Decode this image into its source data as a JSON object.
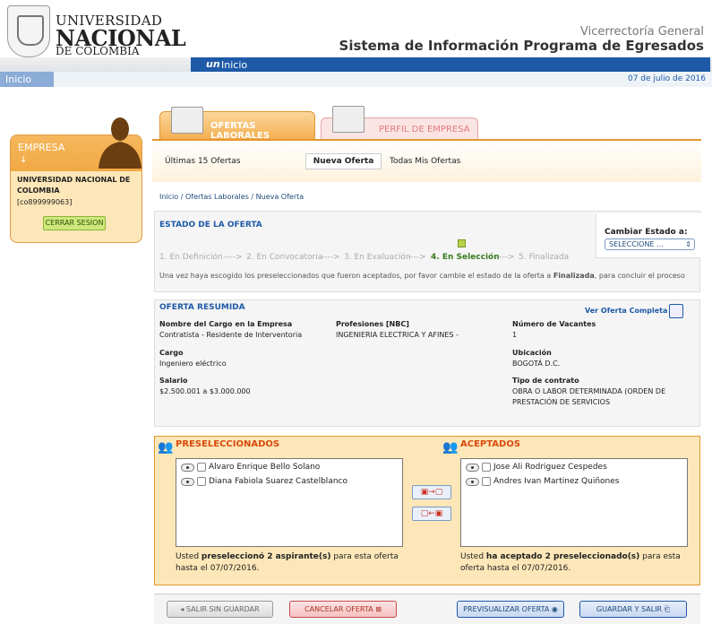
{
  "header": {
    "logo_line1": "UNIVERSIDAD",
    "logo_line2": "NACIONAL",
    "logo_line3": "DE COLOMBIA",
    "vicerrectoria": "Vicerrectoría General",
    "system_title": "Sistema de Información Programa de Egresados",
    "nav_tab": "Inicio",
    "nav_tab_logo": "un",
    "breadcrumb_top": "Inicio",
    "date": "07 de julio de 2016"
  },
  "sidebar": {
    "title": "EMPRESA",
    "arrow": "↓",
    "company_name": "UNIVERSIDAD NACIONAL DE COLOMBIA",
    "company_code": "[co899999063]",
    "logout_label": "CERRAR SESION"
  },
  "tabs": [
    {
      "label": "OFERTAS LABORALES"
    },
    {
      "label": "PERFIL DE EMPRESA"
    }
  ],
  "subnav": {
    "item1": "Últimas 15 Ofertas",
    "item2": "Nueva Oferta",
    "item3": "Todas Mis Ofertas"
  },
  "breadcrumb": "Inicio / Ofertas Laborales / Nueva Oferta",
  "estado": {
    "title": "ESTADO DE LA OFERTA",
    "steps": [
      "1. En Definición",
      "2. En Convocatoria",
      "3. En Evaluación",
      "4. En Selección",
      "5. Finalizada"
    ],
    "arrow": "---->",
    "cambiar_label": "Cambiar Estado a:",
    "select_value": "SELECCIONE ...",
    "message_pre": "Una vez haya escogido los preseleccionados que fueron aceptados, por favor cambie el estado de la oferta a ",
    "message_bold": "Finalizada",
    "message_post": ", para concluir el proceso"
  },
  "oferta": {
    "title": "OFERTA RESUMIDA",
    "ver_link": "Ver Oferta Completa",
    "cargo_empresa_label": "Nombre del Cargo en la Empresa",
    "cargo_empresa": "Contratista - Residente de Interventoria",
    "profesiones_label": "Profesiones [NBC]",
    "profesiones": "INGENIERIA ELECTRICA Y AFINES -",
    "vacantes_label": "Número de Vacantes",
    "vacantes": "1",
    "cargo_label": "Cargo",
    "cargo": "Ingeniero eléctrico",
    "ubicacion_label": "Ubicación",
    "ubicacion": "BOGOTÁ D.C.",
    "salario_label": "Salario",
    "salario": "$2.500.001 a $3.000.000",
    "contrato_label": "Tipo de contrato",
    "contrato_l1": "OBRA O LABOR DETERMINADA (ORDEN DE",
    "contrato_l2": "PRESTACIÓN DE SERVICIOS"
  },
  "seleccion": {
    "pre_title": "PRESELECCIONADOS",
    "acc_title": "ACEPTADOS",
    "preselected": [
      "Alvaro Enrique Bello Solano",
      "Diana Fabiola Suarez Castelblanco"
    ],
    "accepted": [
      "Jose Ali Rodriguez Cespedes",
      "Andres Ivan Martinez Quiñones"
    ],
    "pre_msg_pre": "Usted ",
    "pre_msg_bold": "preseleccionó 2 aspirante(s)",
    "pre_msg_post": " para esta oferta",
    "pre_msg_line2": "hasta el 07/07/2016.",
    "acc_msg_pre": "Usted ",
    "acc_msg_bold": "ha aceptado 2 preseleccionado(s)",
    "acc_msg_post": " para esta",
    "acc_msg_line2": "oferta hasta el 07/07/2016."
  },
  "buttons": {
    "salir": "SALIR SIN GUARDAR",
    "cancelar": "CANCELAR OFERTA",
    "previsualizar": "PREVISUALIZAR OFERTA",
    "guardar": "GUARDAR Y SALIR"
  },
  "colors": {
    "orange": "#f1a945",
    "blue": "#1e5aa7",
    "panel_bg": "#fde7b8"
  }
}
